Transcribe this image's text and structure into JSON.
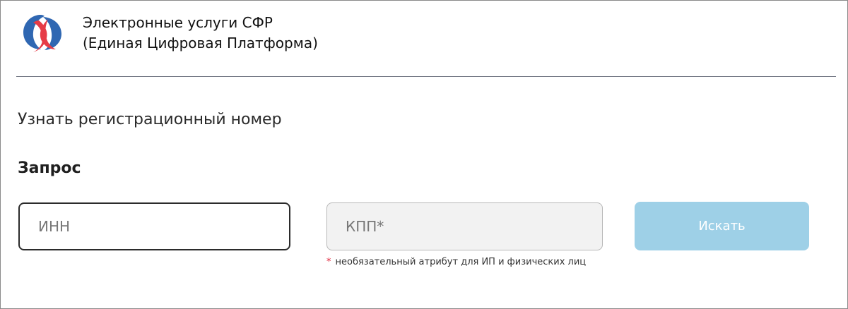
{
  "header": {
    "title_line1": "Электронные услуги СФР",
    "title_line2": "(Единая Цифровая Платформа)",
    "logo_icon": "sfr-logo-icon",
    "logo_colors": {
      "primary": "#2f67b2",
      "accent": "#e63b46"
    }
  },
  "page": {
    "title": "Узнать регистрационный номер"
  },
  "request": {
    "section_title": "Запрос",
    "inn_placeholder": "ИНН",
    "kpp_placeholder": "КПП*",
    "search_label": "Искать",
    "hint_marker": "*",
    "hint_text": "необязательный атрибут для ИП и физических лиц"
  },
  "colors": {
    "button": "#9ed0e7",
    "divider": "#6f7380",
    "asterisk": "#e0243a"
  }
}
